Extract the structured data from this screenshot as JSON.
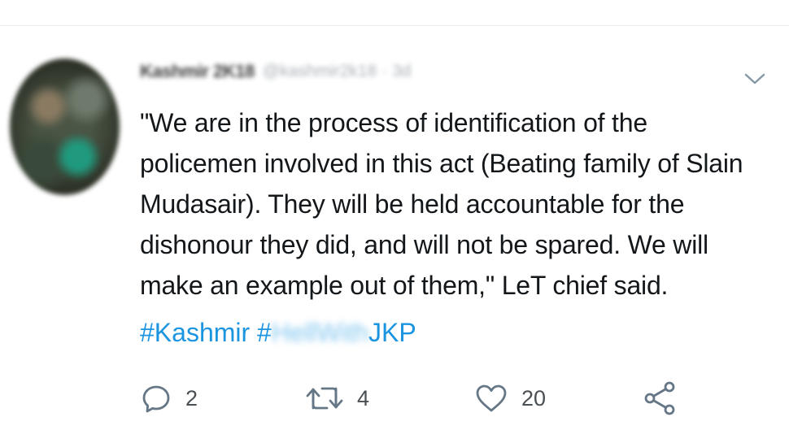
{
  "tweet": {
    "author": {
      "display_name": "Kashmir 2K18",
      "handle": "@kashmir2k18",
      "separator": "·",
      "time": "3d"
    },
    "text_lines": [
      "\"We are in the process of identification of the",
      "policemen involved in this act (Beating family of Slain",
      "Mudasair). They will be held accountable for the",
      "dishonour they did, and will not be spared. We will",
      "make an example out of them,\" LeT chief said."
    ],
    "hashtags": {
      "first": "#Kashmir",
      "second_prefix": "#",
      "second_blurred": "HellWith",
      "second_suffix": "JKP"
    },
    "actions": {
      "reply_count": "2",
      "retweet_count": "4",
      "like_count": "20"
    }
  },
  "icons": {
    "caret": "chevron-down-icon",
    "reply": "reply-icon",
    "retweet": "retweet-icon",
    "like": "heart-icon",
    "share": "share-icon"
  },
  "colors": {
    "text": "#14171a",
    "hashtag": "#1b95e0",
    "icon": "#657786"
  }
}
